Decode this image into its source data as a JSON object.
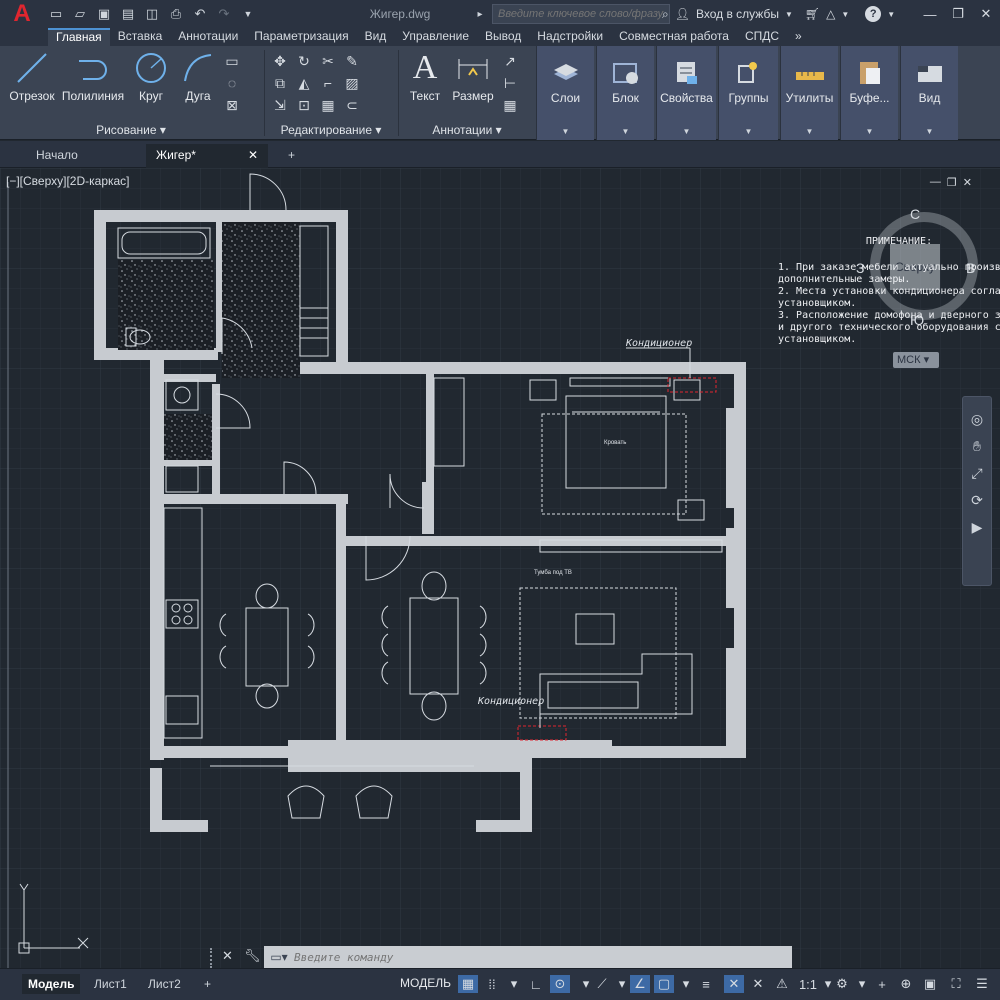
{
  "app": {
    "logo_letter": "A",
    "doc_title": "Жигер.dwg"
  },
  "search": {
    "placeholder": "Введите ключевое слово/фразу",
    "signin": "Вход в службы",
    "help": "?"
  },
  "ribbon_tabs": [
    "Главная",
    "Вставка",
    "Аннотации",
    "Параметризация",
    "Вид",
    "Управление",
    "Вывод",
    "Надстройки",
    "Совместная работа",
    "СПДС",
    "»"
  ],
  "ribbon": {
    "draw": {
      "title": "Рисование",
      "line": "Отрезок",
      "polyline": "Полилиния",
      "circle": "Круг",
      "arc": "Дуга"
    },
    "edit": {
      "title": "Редактирование"
    },
    "annot": {
      "title": "Аннотации",
      "text": "Текст",
      "dim": "Размер"
    },
    "layers": "Слои",
    "block": "Блок",
    "props": "Свойства",
    "groups": "Группы",
    "utils": "Утилиты",
    "clipboard": "Буфе...",
    "view": "Вид"
  },
  "filetabs": {
    "start": "Начало",
    "current": "Жигер*",
    "add": "+"
  },
  "viewport": {
    "label": "[−][Сверху][2D-каркас]"
  },
  "viewcube": {
    "top": "Сверху",
    "n": "С",
    "s": "Ю",
    "e": "В",
    "w": "З",
    "ucs": "МСК"
  },
  "note": {
    "title": "ПРИМЕЧАНИЕ:",
    "lines": [
      "1.  При заказе мебели актуально произв",
      "дополнительные замеры.",
      "2.  Места установки кондиционера соглас",
      "установщиком.",
      "3.  Расположение домофона и дверного зв",
      "и другого технического оборудования сог",
      "установщиком."
    ]
  },
  "plan_labels": {
    "ac_top": "Кондиционер",
    "ac_bottom": "Кондиционер",
    "bed": "Кровать",
    "sofa_table": "Тумба под ТВ"
  },
  "command": {
    "placeholder": "Введите команду"
  },
  "status": {
    "tabs": [
      "Модель",
      "Лист1",
      "Лист2"
    ],
    "add": "+",
    "model": "МОДЕЛЬ",
    "scale": "1:1"
  },
  "colors": {
    "accent": "#4d92d3",
    "logo": "#e0262f",
    "ac_marker": "#e0262f"
  }
}
